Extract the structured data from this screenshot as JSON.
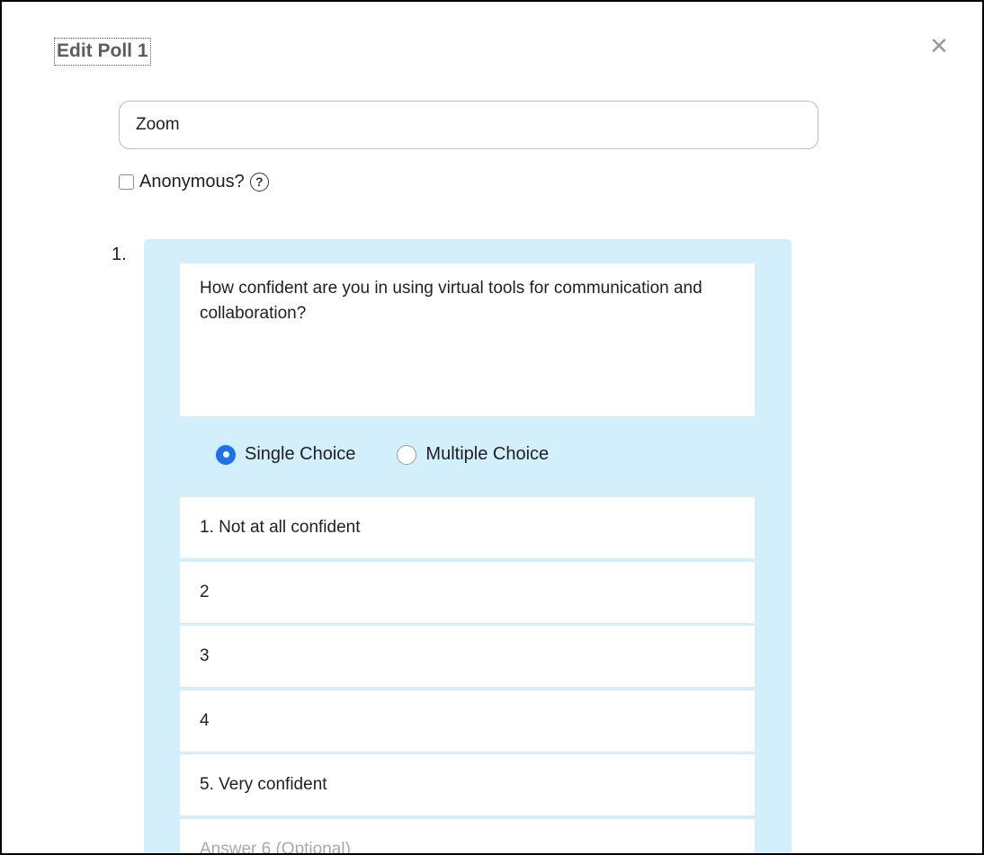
{
  "dialog": {
    "title": "Edit Poll 1",
    "close_icon": "close-icon"
  },
  "poll": {
    "title_value": "Zoom",
    "anonymous_label": "Anonymous?",
    "anonymous_checked": false,
    "help_icon": "question-circle-icon"
  },
  "question": {
    "number": "1.",
    "text": "How confident are you in using virtual tools for communication and collaboration?",
    "choice_types": [
      {
        "label": "Single Choice",
        "selected": true
      },
      {
        "label": "Multiple Choice",
        "selected": false
      }
    ],
    "answers": [
      {
        "value": "1. Not at all confident"
      },
      {
        "value": "2"
      },
      {
        "value": "3"
      },
      {
        "value": "4"
      },
      {
        "value": "5. Very confident"
      },
      {
        "placeholder": "Answer 6 (Optional)"
      }
    ]
  },
  "colors": {
    "card_background": "#d3effc",
    "accent": "#1a73e8"
  }
}
